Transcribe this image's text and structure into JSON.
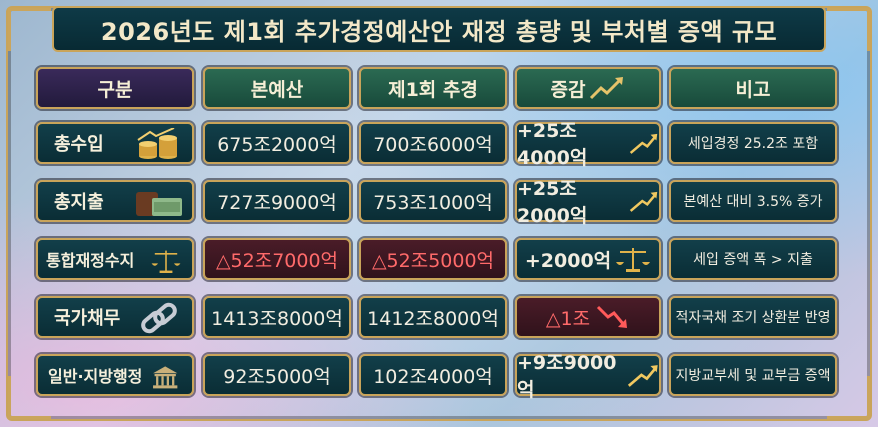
{
  "title": "2026년도 제1회 추가경정예산안 재정 총량 및 부처별 증액 규모",
  "headers": [
    "구분",
    "본예산",
    "제1회 추경",
    "증감",
    "비고"
  ],
  "rows": [
    {
      "label": "총수입",
      "icon": "coin-stack-icon",
      "base": "675조2000억",
      "supp": "700조6000억",
      "diff": "+25조4000억",
      "diff_icon": "up-arrow-icon",
      "note": "세입경정 25.2조 포함"
    },
    {
      "label": "총지출",
      "icon": "wallet-cash-icon",
      "base": "727조9000억",
      "supp": "753조1000억",
      "diff": "+25조2000억",
      "diff_icon": "up-arrow-icon",
      "note": "본예산 대비 3.5% 증가"
    },
    {
      "label": "통합재정수지",
      "icon": "scale-icon",
      "base": "△52조7000억",
      "supp": "△52조5000억",
      "diff": "+2000억",
      "diff_icon": "scale-icon",
      "note": "세입 증액 폭 > 지출"
    },
    {
      "label": "국가채무",
      "icon": "chain-link-icon",
      "base": "1413조8000억",
      "supp": "1412조8000억",
      "diff": "△1조",
      "diff_icon": "down-arrow-icon",
      "note": "적자국채 조기 상환분 반영"
    },
    {
      "label": "일반·지방행정",
      "icon": "government-building-icon",
      "base": "92조5000억",
      "supp": "102조4000억",
      "diff": "+9조9000억",
      "diff_icon": "up-arrow-icon",
      "note": "지방교부세 및 교부금 증액"
    }
  ]
}
